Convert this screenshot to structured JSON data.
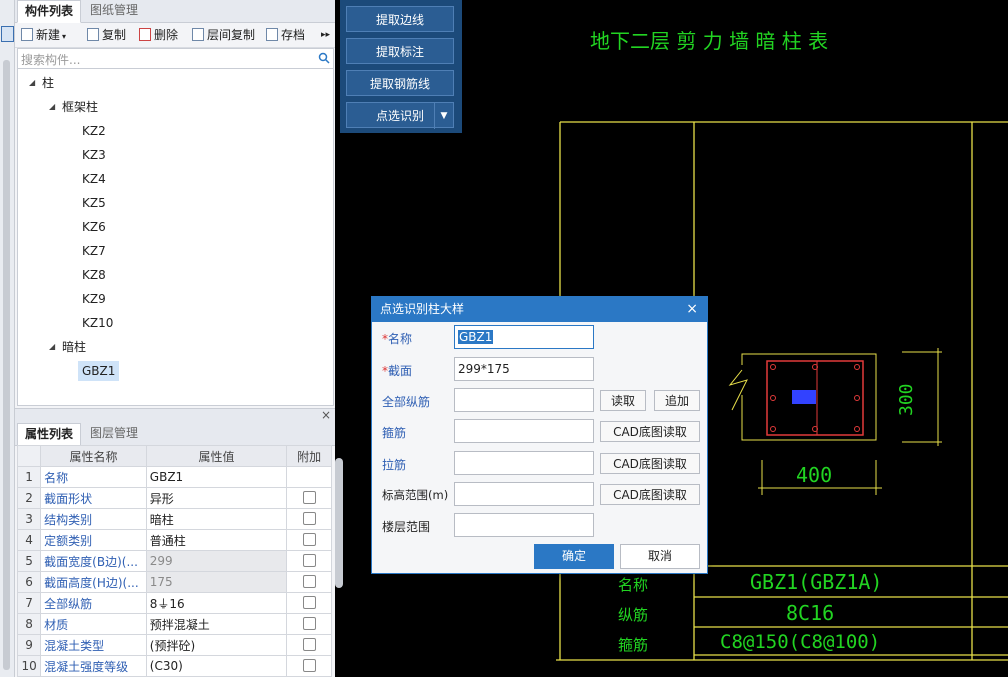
{
  "left_panel": {
    "tabs": [
      "构件列表",
      "图纸管理"
    ],
    "toolbar": {
      "new": "新建",
      "copy": "复制",
      "delete": "删除",
      "floor_copy": "层间复制",
      "save": "存档",
      "more": "▸▸"
    },
    "search_placeholder": "搜索构件...",
    "tree": {
      "root": "柱",
      "group1": "框架柱",
      "group1_items": [
        "KZ2",
        "KZ3",
        "KZ4",
        "KZ5",
        "KZ6",
        "KZ7",
        "KZ8",
        "KZ9",
        "KZ10"
      ],
      "group2": "暗柱",
      "group2_items": [
        "GBZ1"
      ]
    },
    "close_glyph": "×"
  },
  "property_panel": {
    "tabs": [
      "属性列表",
      "图层管理"
    ],
    "columns": [
      "属性名称",
      "属性值",
      "附加"
    ],
    "rows": [
      {
        "num": "1",
        "name": "名称",
        "value": "GBZ1"
      },
      {
        "num": "2",
        "name": "截面形状",
        "value": "异形"
      },
      {
        "num": "3",
        "name": "结构类别",
        "value": "暗柱"
      },
      {
        "num": "4",
        "name": "定额类别",
        "value": "普通柱"
      },
      {
        "num": "5",
        "name": "截面宽度(B边)(...",
        "value": "299"
      },
      {
        "num": "6",
        "name": "截面高度(H边)(...",
        "value": "175"
      },
      {
        "num": "7",
        "name": "全部纵筋",
        "value": "8⏚16"
      },
      {
        "num": "8",
        "name": "材质",
        "value": "预拌混凝土"
      },
      {
        "num": "9",
        "name": "混凝土类型",
        "value": "(预拌砼)"
      },
      {
        "num": "10",
        "name": "混凝土强度等级",
        "value": "(C30)"
      }
    ]
  },
  "tool_panel": {
    "buttons": [
      "提取边线",
      "提取标注",
      "提取钢筋线",
      "点选识别"
    ]
  },
  "cad": {
    "title": "地下二层 剪 力 墙 暗 柱 表",
    "dim_height": "300",
    "dim_width": "400",
    "row_labels": [
      "名称",
      "纵筋",
      "箍筋"
    ],
    "name_value": "GBZ1(GBZ1A)",
    "long_rebar": "8C16",
    "stirrup": "C8@150(C8@100)"
  },
  "dialog": {
    "title": "点选识别柱大样",
    "close": "×",
    "required_mark": "*",
    "labels": {
      "name": "名称",
      "section": "截面",
      "all_rebar": "全部纵筋",
      "stirrup": "箍筋",
      "tie": "拉筋",
      "elevation": "标高范围(m)",
      "floor": "楼层范围"
    },
    "values": {
      "name": "GBZ1",
      "section": "299*175"
    },
    "btn_read": "读取",
    "btn_append": "追加",
    "btn_cad_read": "CAD底图读取",
    "ok": "确定",
    "cancel": "取消"
  }
}
